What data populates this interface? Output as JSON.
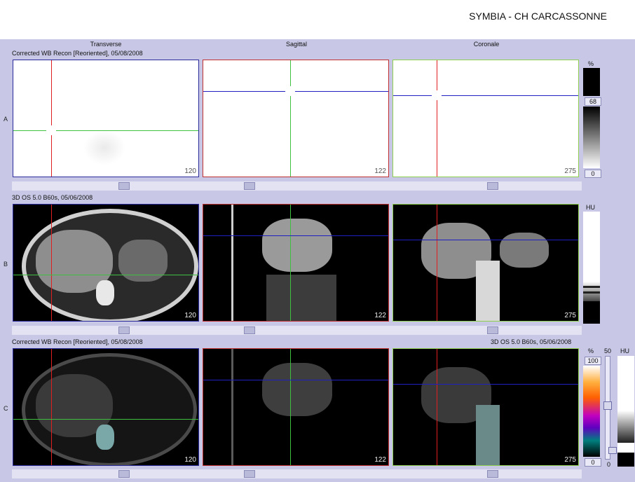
{
  "header": {
    "title": "SYMBIA - CH CARCASSONNE"
  },
  "columns": [
    "Transverse",
    "Sagittal",
    "Coronale"
  ],
  "rows": {
    "a": {
      "label": "A",
      "series": "Corrected WB Recon [Reoriented], 05/08/2008",
      "slices": [
        "120",
        "122",
        "275"
      ]
    },
    "b": {
      "label": "B",
      "series": "3D  OS  5.0  B60s, 05/06/2008",
      "slices": [
        "120",
        "122",
        "275"
      ]
    },
    "c": {
      "label": "C",
      "series_left": "Corrected WB Recon [Reoriented], 05/08/2008",
      "series_right": "3D  OS  5.0  B60s, 05/06/2008",
      "slices": [
        "120",
        "122",
        "275"
      ]
    }
  },
  "colorbars": {
    "a": {
      "unit": "%",
      "max": "68",
      "min": "0"
    },
    "b": {
      "unit": "HU"
    },
    "c": {
      "unit_pet": "%",
      "unit_ct": "HU",
      "max": "100",
      "min": "0",
      "blend": "50",
      "blend_min": "0"
    }
  },
  "colors": {
    "transverse_border": "#2a2a9a",
    "sagittal_border": "#c03030",
    "coronal_border": "#90d050",
    "crosshair_red": "#e02020",
    "crosshair_green": "#40c040",
    "crosshair_blue": "#2020c0"
  }
}
